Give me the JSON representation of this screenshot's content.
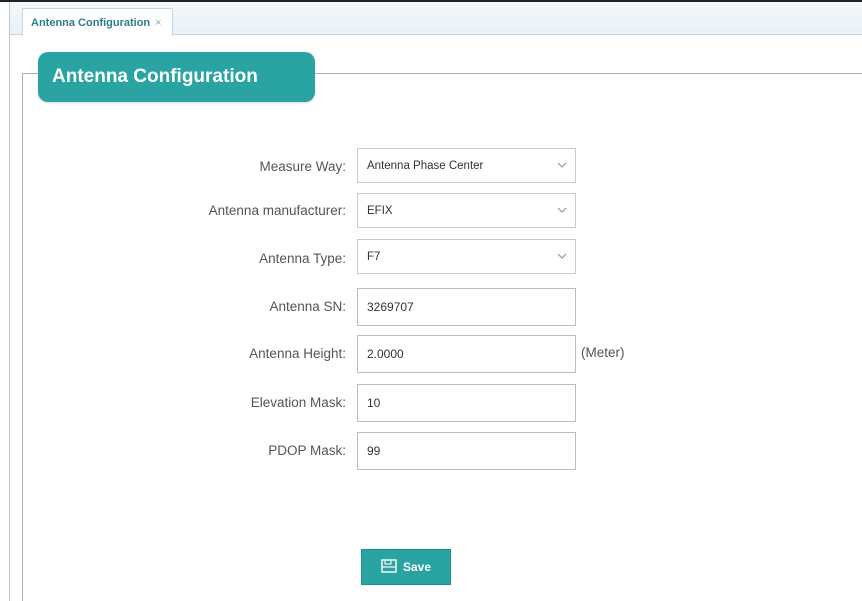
{
  "tabs": [
    {
      "label": "Antenna Configuration",
      "close_glyph": "×"
    }
  ],
  "section": {
    "title": "Antenna Configuration"
  },
  "form": {
    "measure_way": {
      "label": "Measure Way:",
      "value": "Antenna Phase Center"
    },
    "manufacturer": {
      "label": "Antenna manufacturer:",
      "value": "EFIX"
    },
    "antenna_type": {
      "label": "Antenna Type:",
      "value": "F7"
    },
    "antenna_sn": {
      "label": "Antenna SN:",
      "value": "3269707"
    },
    "antenna_height": {
      "label": "Antenna Height:",
      "value": "2.0000",
      "unit": "(Meter)"
    },
    "elevation_mask": {
      "label": "Elevation Mask:",
      "value": "10"
    },
    "pdop_mask": {
      "label": "PDOP Mask:",
      "value": "99"
    }
  },
  "actions": {
    "save_label": "Save",
    "save_icon": "save-icon"
  },
  "colors": {
    "accent": "#2aa3a3",
    "tab_text": "#2a7f8a",
    "border": "#9fb7b9"
  }
}
